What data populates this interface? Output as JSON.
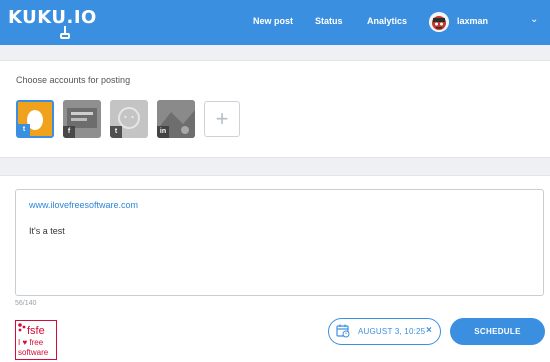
{
  "header": {
    "logo": "KUKU.IO",
    "nav": [
      "New post",
      "Status",
      "Analytics"
    ],
    "user_name": "laxman",
    "chevron": "⌄"
  },
  "accounts": {
    "title": "Choose accounts for posting",
    "items": [
      {
        "network": "t",
        "icon": "twitter-icon",
        "selected": true
      },
      {
        "network": "f",
        "icon": "facebook-icon",
        "selected": false
      },
      {
        "network": "t",
        "icon": "tumblr-icon",
        "selected": false
      },
      {
        "network": "in",
        "icon": "linkedin-icon",
        "selected": false
      }
    ],
    "add_label": "+"
  },
  "compose": {
    "link": "www.ilovefreesoftware.com",
    "text": "It's a test",
    "counter": "56/140"
  },
  "logo_badge": {
    "icon": "fsfe-logo",
    "lines": [
      "fsfe",
      "I ♥ free",
      "software"
    ]
  },
  "schedule": {
    "date": "AUGUST 3, 10:25",
    "clear": "×",
    "button": "SCHEDULE"
  },
  "colors": {
    "accent": "#3b8fe0",
    "fsfe_red": "#d10d39"
  }
}
